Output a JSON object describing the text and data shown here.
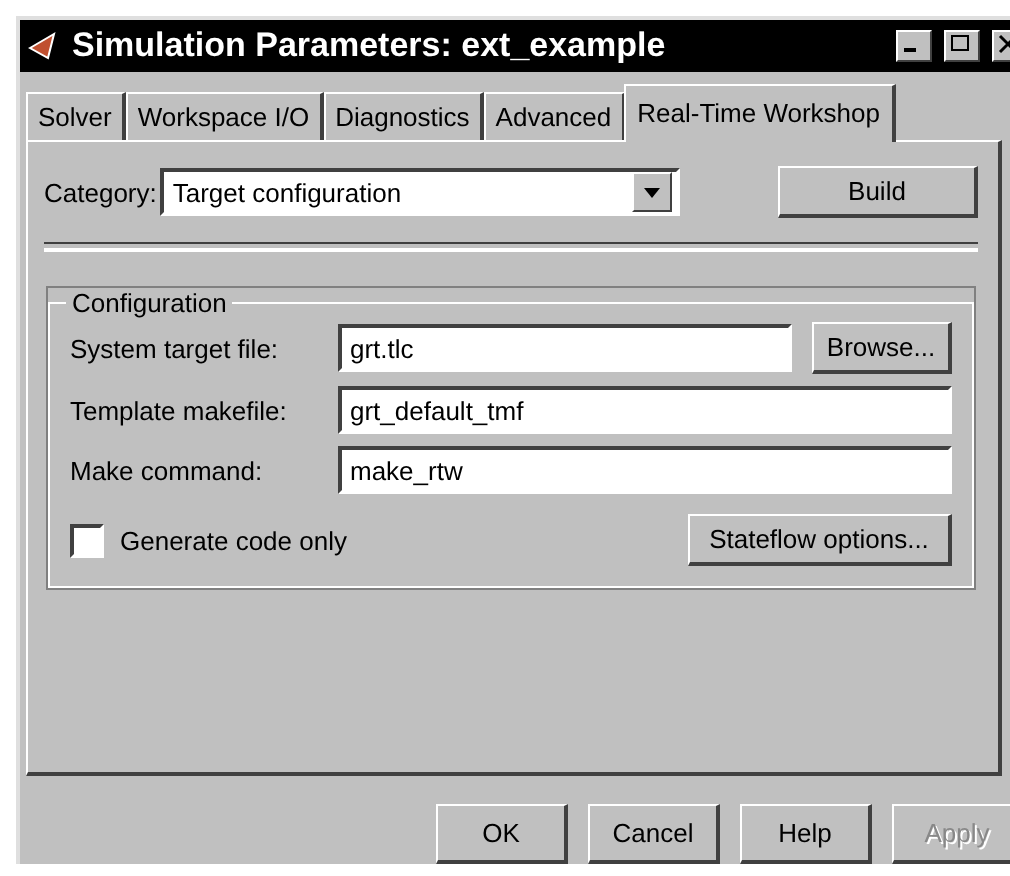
{
  "window": {
    "title": "Simulation Parameters: ext_example"
  },
  "tabs": [
    {
      "label": "Solver",
      "selected": false
    },
    {
      "label": "Workspace I/O",
      "selected": false
    },
    {
      "label": "Diagnostics",
      "selected": false
    },
    {
      "label": "Advanced",
      "selected": false
    },
    {
      "label": "Real-Time Workshop",
      "selected": true
    }
  ],
  "category": {
    "label": "Category:",
    "value": "Target configuration"
  },
  "build_button": "Build",
  "configuration": {
    "title": "Configuration",
    "fields": [
      {
        "label": "System target file:",
        "value": "grt.tlc",
        "button": "Browse..."
      },
      {
        "label": "Template makefile:",
        "value": "grt_default_tmf"
      },
      {
        "label": "Make command:",
        "value": "make_rtw"
      }
    ],
    "generate_code_only": {
      "label": "Generate code only",
      "checked": false
    },
    "stateflow_button": "Stateflow options..."
  },
  "buttons": [
    {
      "label": "OK",
      "disabled": false
    },
    {
      "label": "Cancel",
      "disabled": false
    },
    {
      "label": "Help",
      "disabled": false
    },
    {
      "label": "Apply",
      "disabled": true
    }
  ]
}
